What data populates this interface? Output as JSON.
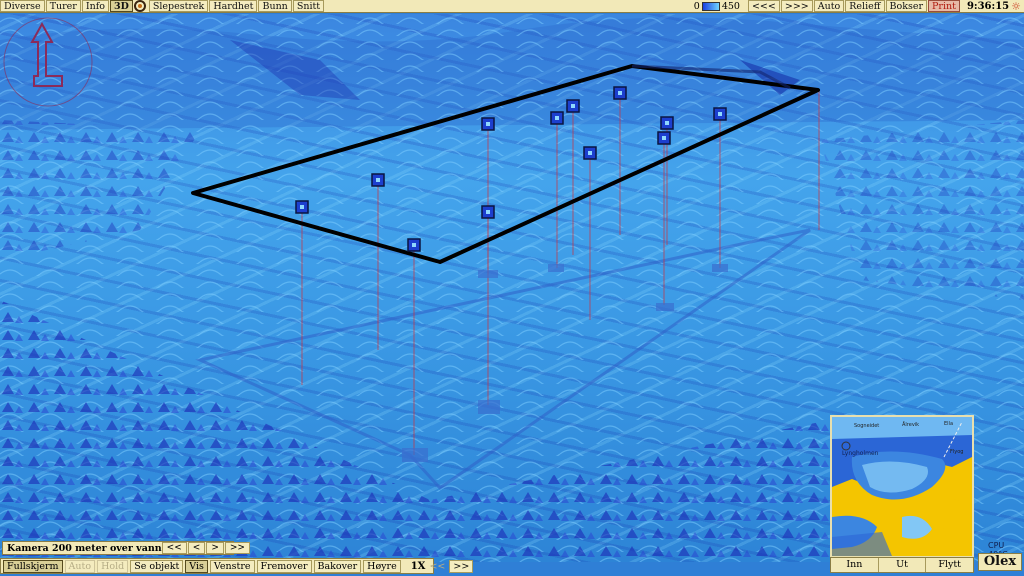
{
  "toolbar": {
    "items": [
      "Diverse",
      "Turer",
      "Info",
      "3D"
    ],
    "items_after_target": [
      "Slepestrek",
      "Hardhet",
      "Bunn",
      "Snitt"
    ],
    "scale_min": "0",
    "scale_max": "450",
    "prev": "<<<",
    "next": ">>>",
    "auto": "Auto",
    "relief": "Relieff",
    "boxes": "Bokser",
    "print": "Print",
    "time": "9:36:15"
  },
  "camera": {
    "label": "Kamera 200 meter over vann",
    "buttons": [
      "<<",
      "<",
      ">",
      ">>"
    ]
  },
  "bottom": {
    "fullscreen": "Fullskjerm",
    "auto": "Auto",
    "hold": "Hold",
    "see_object": "Se objekt",
    "view": "Vis",
    "left": "Venstre",
    "forward": "Fremover",
    "backward": "Bakover",
    "right": "Høyre",
    "speed": "1X",
    "slower": "<<",
    "faster": ">>"
  },
  "minimap": {
    "labels": [
      "Sogneidet",
      "Ålrevik",
      "Ella",
      "Lyngholmen",
      "Flyog"
    ],
    "buttons": [
      "Inn",
      "Ut",
      "Flytt"
    ]
  },
  "status": {
    "cpu": "CPU 40°C",
    "brand": "Olex"
  },
  "colors": {
    "toolbar_bg": "#f2e9b8",
    "print_text": "#b01b0f",
    "sea_deep": "#1a3fe0",
    "sea_shallow": "#6fd3ff",
    "land": "#f4c500"
  }
}
